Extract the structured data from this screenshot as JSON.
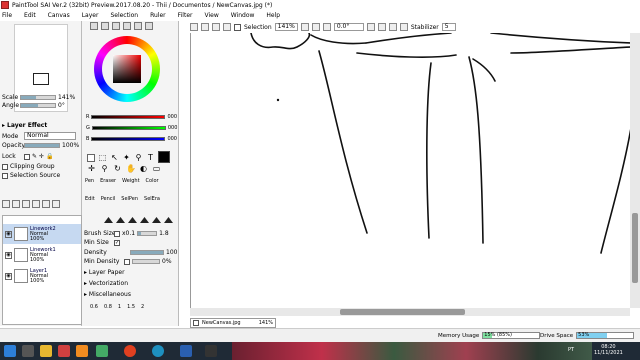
{
  "window": {
    "title": "PaintTool SAI Ver.2 (32bit) Preview.2017.08.20 - Thii / Documentos / NewCanvas.jpg (*)"
  },
  "menubar": {
    "items": [
      "File",
      "Edit",
      "Canvas",
      "Layer",
      "Selection",
      "Ruler",
      "Filter",
      "View",
      "Window",
      "Help"
    ]
  },
  "toolbar": {
    "selection_label": "Selection",
    "zoom_value": "141%",
    "rotation_value": "0.0°",
    "stabilizer_label": "Stabilizer",
    "stabilizer_value": "5"
  },
  "navigator": {
    "scale_label": "Scale",
    "scale_value": "141%",
    "angle_label": "Angle",
    "angle_value": "0°"
  },
  "layer_effect": {
    "header": "Layer Effect",
    "mode_label": "Mode",
    "mode_value": "Normal",
    "opacity_label": "Opacity",
    "opacity_value": "100%",
    "opacity_fraction": 1.0,
    "lock_label": "Lock",
    "clipping_label": "Clipping Group",
    "selection_source_label": "Selection Source"
  },
  "layers": [
    {
      "name": "Linework2",
      "mode": "Normal",
      "opacity": "100%",
      "selected": true
    },
    {
      "name": "Linework1",
      "mode": "Normal",
      "opacity": "100%",
      "selected": false
    },
    {
      "name": "Layer1",
      "mode": "Normal",
      "opacity": "100%",
      "selected": false
    }
  ],
  "color": {
    "r_label": "R",
    "r_value": "000",
    "g_label": "G",
    "g_value": "000",
    "b_label": "B",
    "b_value": "000",
    "current": "#000000"
  },
  "tool_tabs": {
    "row1": [
      "Pen",
      "Eraser",
      "Weight",
      "Color"
    ],
    "row2": [
      "Edit",
      "Pencil",
      "SelPen",
      "SelEra"
    ]
  },
  "brush": {
    "brush_size_label": "Brush Size",
    "brush_size_multiplier": "x0.1",
    "brush_size_value": "1.8",
    "min_size_label": "Min Size",
    "density_label": "Density",
    "density_value": "100",
    "min_density_label": "Min Density",
    "min_density_value": "0%"
  },
  "sections": [
    "Layer Paper",
    "Vectorization",
    "Miscellaneous"
  ],
  "size_presets": [
    "0.6",
    "0.8",
    "1",
    "1.5",
    "2"
  ],
  "file_tab": {
    "name": "NewCanvas.jpg",
    "zoom": "141%"
  },
  "status": {
    "memory_label": "Memory Usage",
    "memory_value": "15% (85%)",
    "memory_fraction": 0.15,
    "drive_label": "Drive Space",
    "drive_value": "53%",
    "drive_fraction": 0.53
  },
  "taskbar": {
    "lang": "PT",
    "time": "08:20",
    "date": "11/11/2021"
  },
  "colors": {
    "selected_layer": "#c6d9f1",
    "memory_fill": "#7fe0a0",
    "drive_fill": "#80d0f0"
  }
}
